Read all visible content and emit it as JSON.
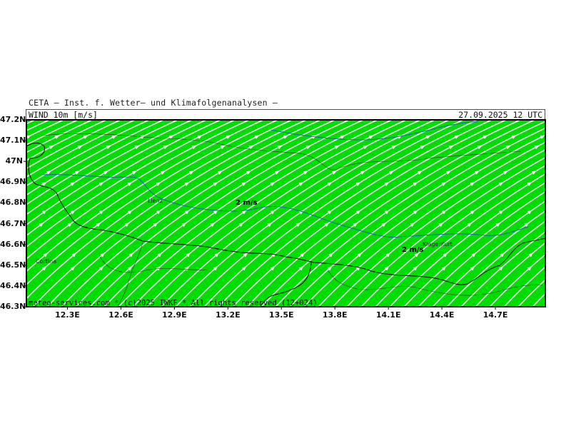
{
  "header": {
    "institution": "CETA — Inst. f. Wetter— und Klimafolgenanalysen —",
    "field_label": "WIND 10m [m/s]",
    "valid_time": "27.09.2025 12 UTC"
  },
  "credit": "meteo-services.com * (c)2025 IWKF * All rights reserved (12+024)",
  "map": {
    "extent": {
      "lon_min": 12.07,
      "lon_max": 14.98,
      "lat_min": 46.3,
      "lat_max": 47.2
    },
    "lat_ticks": [
      "47.2N",
      "47.1N",
      "47N",
      "46.9N",
      "46.8N",
      "46.7N",
      "46.6N",
      "46.5N",
      "46.4N",
      "46.3N"
    ],
    "lon_ticks": [
      "12.3E",
      "12.6E",
      "12.9E",
      "13.2E",
      "13.5E",
      "13.8E",
      "14.1E",
      "14.4E",
      "14.7E"
    ],
    "contour_labels": [
      "2 m/s",
      "2 m/s"
    ],
    "towns": [
      "Lienz",
      "Cortina",
      "Klagenfurt"
    ],
    "colors": {
      "fill": "#00dd00",
      "streamline": "#ffffff",
      "isotach_2ms": "#1e5fb4",
      "country_border": "#000000",
      "region_border": "#333333"
    },
    "flow": "streamlines from south-west curving to north-east"
  }
}
